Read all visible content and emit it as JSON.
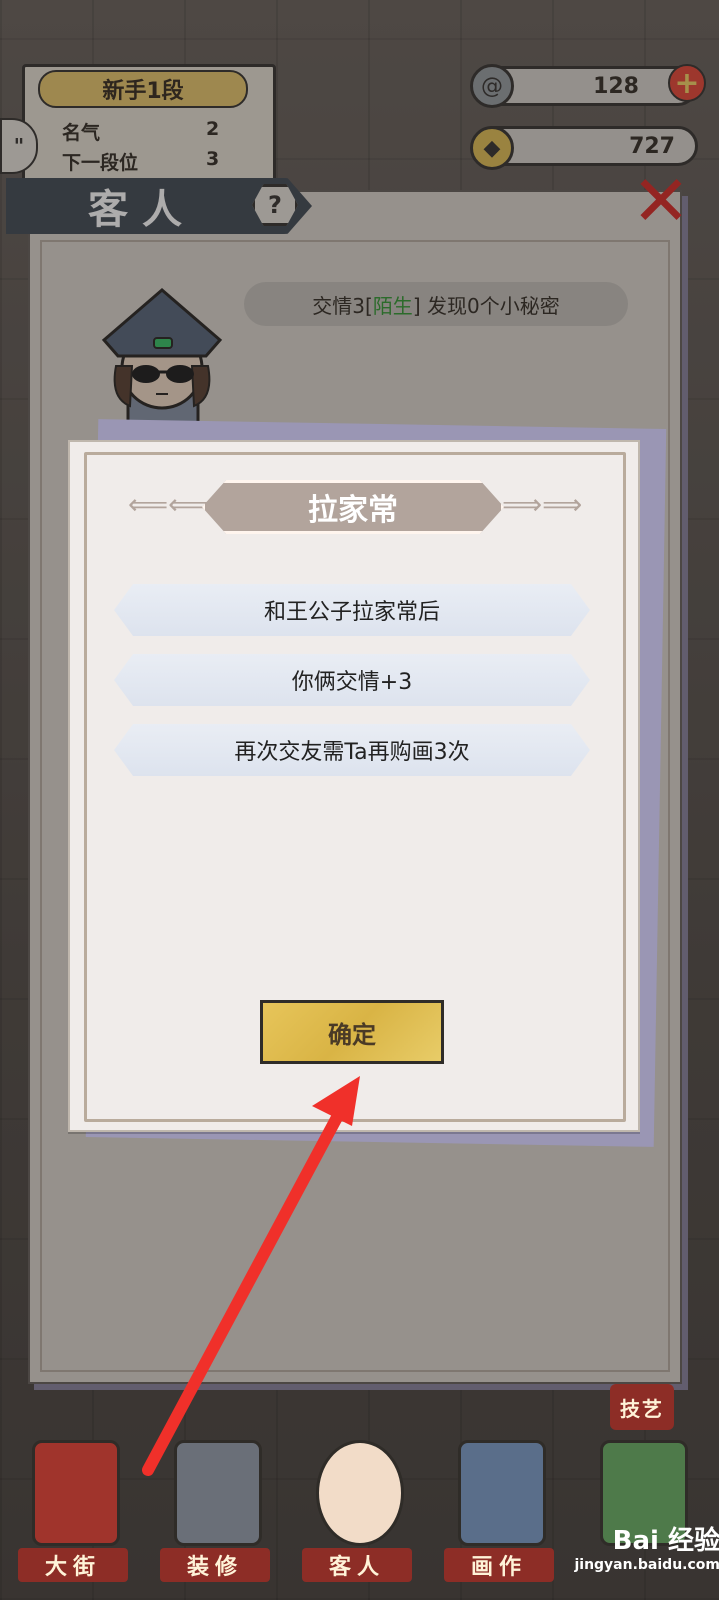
{
  "player": {
    "rank": "新手1段",
    "stats": [
      {
        "label": "名气",
        "value": "2"
      },
      {
        "label": "下一段位",
        "value": "3"
      }
    ]
  },
  "currencies": [
    {
      "icon": "swirl-icon",
      "amount": "128"
    },
    {
      "icon": "coin-icon",
      "amount": "727"
    }
  ],
  "guest_panel": {
    "title": "客人",
    "friendship_prefix": "交情3[",
    "friendship_status": "陌生",
    "friendship_suffix": "] 发现0个小秘密"
  },
  "modal": {
    "title": "拉家常",
    "lines": [
      "和王公子拉家常后",
      "你俩交情+3",
      "再次交友需Ta再购画3次"
    ],
    "confirm_label": "确定"
  },
  "bottom_nav": [
    {
      "label": "大街",
      "name": "street"
    },
    {
      "label": "装修",
      "name": "decorate"
    },
    {
      "label": "客人",
      "name": "guests"
    },
    {
      "label": "画作",
      "name": "paintings"
    },
    {
      "label": "",
      "name": "more"
    }
  ],
  "skill_label": "技艺",
  "watermark": {
    "brand": "Bai 经验",
    "url": "jingyan.baidu.com"
  },
  "colors": {
    "accent_red": "#d9302c",
    "gold": "#e7c55a",
    "status_green": "#3a9b3a",
    "panel_bg": "#dcd6ce"
  }
}
